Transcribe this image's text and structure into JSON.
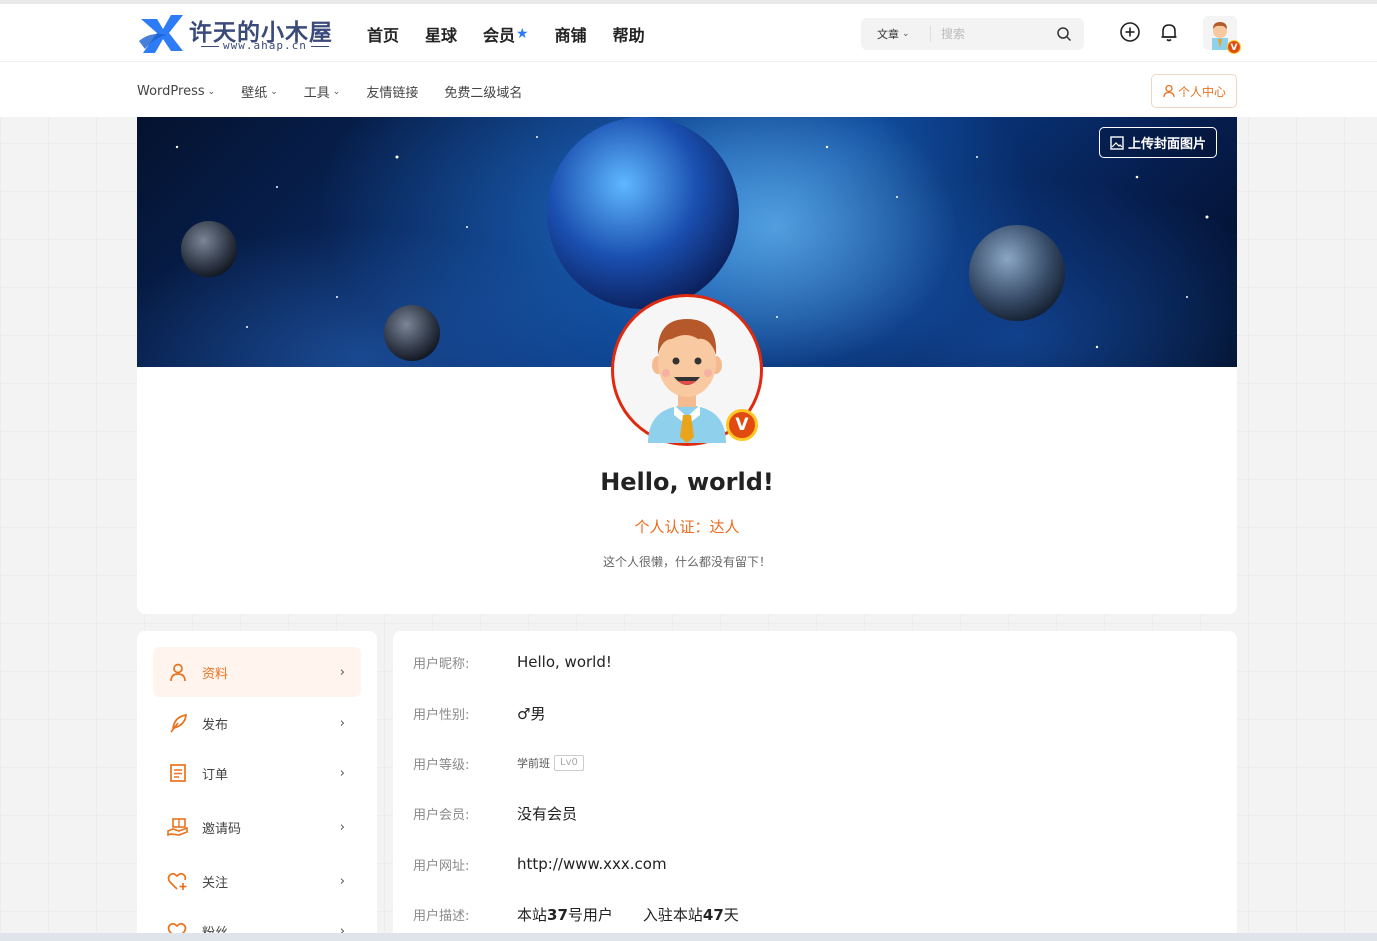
{
  "site": {
    "logo_text": "许天的小木屋",
    "logo_sub": "www.ahap.cn"
  },
  "mainnav": [
    {
      "label": "首页"
    },
    {
      "label": "星球"
    },
    {
      "label": "会员"
    },
    {
      "label": "商铺"
    },
    {
      "label": "帮助"
    }
  ],
  "search": {
    "category": "文章",
    "placeholder": "搜索"
  },
  "subnav": [
    {
      "label": "WordPress",
      "has_dropdown": true
    },
    {
      "label": "壁纸",
      "has_dropdown": true
    },
    {
      "label": "工具",
      "has_dropdown": true
    },
    {
      "label": "友情链接",
      "has_dropdown": false
    },
    {
      "label": "免费二级域名",
      "has_dropdown": false
    }
  ],
  "personal_center_label": "个人中心",
  "cover": {
    "upload_label": "上传封面图片"
  },
  "profile": {
    "name": "Hello, world!",
    "auth": "个人认证：达人",
    "bio": "这个人很懒，什么都没有留下！",
    "vip_badge": "V"
  },
  "sidebar": {
    "items": [
      {
        "label": "资料",
        "icon": "user-icon",
        "active": true
      },
      {
        "label": "发布",
        "icon": "feather-icon",
        "active": false
      },
      {
        "label": "订单",
        "icon": "order-icon",
        "active": false
      },
      {
        "label": "邀请码",
        "icon": "invite-icon",
        "active": false
      },
      {
        "label": "关注",
        "icon": "heart-plus-icon",
        "active": false
      },
      {
        "label": "粉丝",
        "icon": "fans-icon",
        "active": false
      }
    ]
  },
  "details": {
    "nickname_label": "用户昵称:",
    "nickname": "Hello, world!",
    "gender_label": "用户性别:",
    "gender": "♂男",
    "level_label": "用户等级:",
    "level_name": "学前班",
    "level_badge": "Lv0",
    "member_label": "用户会员:",
    "member": "没有会员",
    "url_label": "用户网址:",
    "url": "http://www.xxx.com",
    "desc_label": "用户描述:",
    "user_no_prefix": "本站",
    "user_no": "37",
    "user_no_suffix": "号用户",
    "days_prefix": "入驻本站",
    "days": "47",
    "days_suffix": "天"
  },
  "colors": {
    "accent": "#e8731f",
    "star": "#2d7cf5",
    "vip_red": "#e02a10"
  }
}
